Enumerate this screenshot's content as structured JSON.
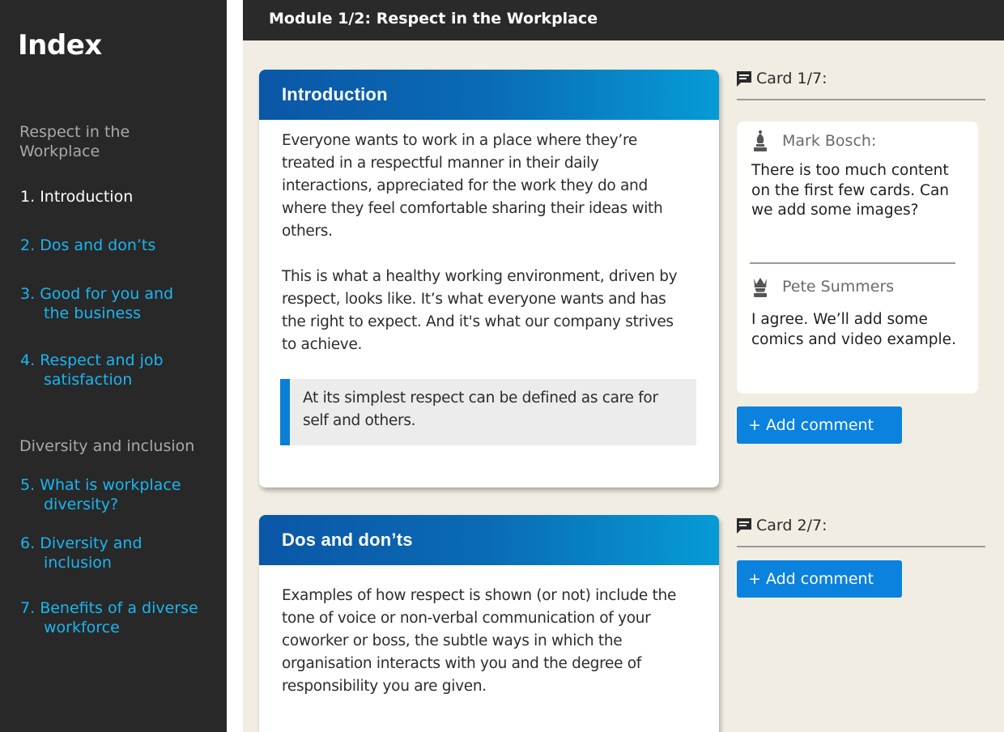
{
  "sidebar": {
    "title": "Index",
    "sections": [
      {
        "label": "Respect in the Workplace",
        "items": [
          {
            "num": "1.",
            "label": "Introduction",
            "label2": "",
            "current": true
          },
          {
            "num": "2.",
            "label": "Dos and don’ts",
            "label2": ""
          },
          {
            "num": "3.",
            "label": "Good for you and",
            "label2": "the business"
          },
          {
            "num": "4.",
            "label": "Respect and job",
            "label2": "satisfaction"
          }
        ]
      },
      {
        "label": "Diversity and inclusion",
        "items": [
          {
            "num": "5.",
            "label": "What is workplace",
            "label2": "diversity?"
          },
          {
            "num": "6.",
            "label": "Diversity and",
            "label2": "inclusion"
          },
          {
            "num": "7.",
            "label": "Benefits of a diverse",
            "label2": "workforce"
          }
        ]
      }
    ]
  },
  "topbar": {
    "title": "Module 1/2: Respect in the Workplace"
  },
  "cards": [
    {
      "title": "Introduction",
      "paragraphs": [
        "Everyone wants to work in a place where they’re treated in a respectful manner in their daily interactions, appreciated for the work they do and where they feel comfortable sharing their ideas with others.",
        "This is what a healthy working environment, driven by respect, looks like. It’s what everyone wants and has the right to expect. And it's what our company strives to achieve."
      ],
      "quote": "At its simplest respect can be defined as care for self and others."
    },
    {
      "title": "Dos and don’ts",
      "paragraphs": [
        "Examples of how respect is shown (or not) include the tone of voice or non-verbal communication of your coworker or boss, the subtle ways in which the organisation interacts with you and the degree of responsibility you are given."
      ]
    }
  ],
  "comments_panel": [
    {
      "label": "Card 1/7:",
      "comments": [
        {
          "author": "Mark Bosch:",
          "icon": "chess-bishop-icon",
          "text": "There is too much content on the first few cards.  Can we add some images?"
        },
        {
          "author": "Pete Summers",
          "icon": "chess-queen-icon",
          "text": "I agree. We’ll add some comics and video example."
        }
      ],
      "add_label": "+ Add comment"
    },
    {
      "label": "Card 2/7:",
      "comments": [],
      "add_label": "+ Add comment"
    }
  ],
  "colors": {
    "sidebar_bg": "#282828",
    "link": "#1ab6f0",
    "header_gradient_start": "#0a57a6",
    "header_gradient_end": "#069bd6",
    "button": "#0a82de",
    "page_bg": "#f2ede2"
  }
}
